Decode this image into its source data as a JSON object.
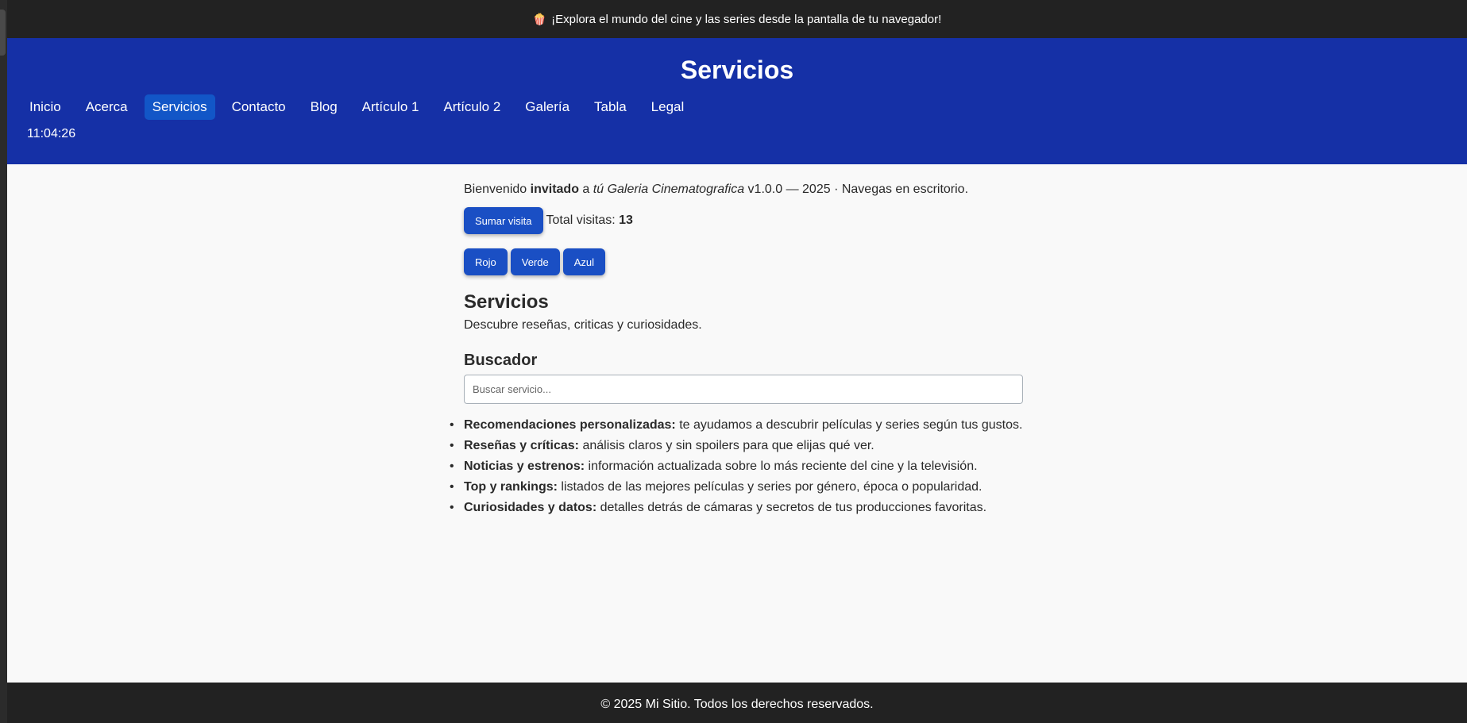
{
  "promo": {
    "icon": "popcorn-icon",
    "text": "¡Explora el mundo del cine y las series desde la pantalla de tu navegador!"
  },
  "header": {
    "title": "Servicios",
    "clock": "11:04:26",
    "nav": [
      {
        "label": "Inicio",
        "active": false
      },
      {
        "label": "Acerca",
        "active": false
      },
      {
        "label": "Servicios",
        "active": true
      },
      {
        "label": "Contacto",
        "active": false
      },
      {
        "label": "Blog",
        "active": false
      },
      {
        "label": "Artículo 1",
        "active": false
      },
      {
        "label": "Artículo 2",
        "active": false
      },
      {
        "label": "Galería",
        "active": false
      },
      {
        "label": "Tabla",
        "active": false
      },
      {
        "label": "Legal",
        "active": false
      }
    ]
  },
  "main": {
    "welcome": {
      "prefix": "Bienvenido",
      "user": "invitado",
      "mid": "a",
      "site": "tú Galeria Cinematografica",
      "suffix": "v1.0.0 — 2025 · Navegas en escritorio."
    },
    "visit_button": "Sumar visita",
    "visit_label": "Total visitas:",
    "visit_count": "13",
    "color_buttons": [
      "Rojo",
      "Verde",
      "Azul"
    ],
    "section_title": "Servicios",
    "section_desc": "Descubre reseñas, criticas y curiosidades.",
    "search_title": "Buscador",
    "search_placeholder": "Buscar servicio...",
    "services": [
      {
        "title": "Recomendaciones personalizadas:",
        "text": "te ayudamos a descubrir películas y series según tus gustos."
      },
      {
        "title": "Reseñas y críticas:",
        "text": "análisis claros y sin spoilers para que elijas qué ver."
      },
      {
        "title": "Noticias y estrenos:",
        "text": "información actualizada sobre lo más reciente del cine y la televisión."
      },
      {
        "title": "Top y rankings:",
        "text": "listados de las mejores películas y series por género, época o popularidad."
      },
      {
        "title": "Curiosidades y datos:",
        "text": "detalles detrás de cámaras y secretos de tus producciones favoritas."
      }
    ]
  },
  "footer": {
    "text": "© 2025 Mi Sitio. Todos los derechos reservados."
  },
  "colors": {
    "header_bg": "#1530a6",
    "active_nav": "#1256c7",
    "button": "#1a4fc4",
    "bars": "#222222"
  }
}
